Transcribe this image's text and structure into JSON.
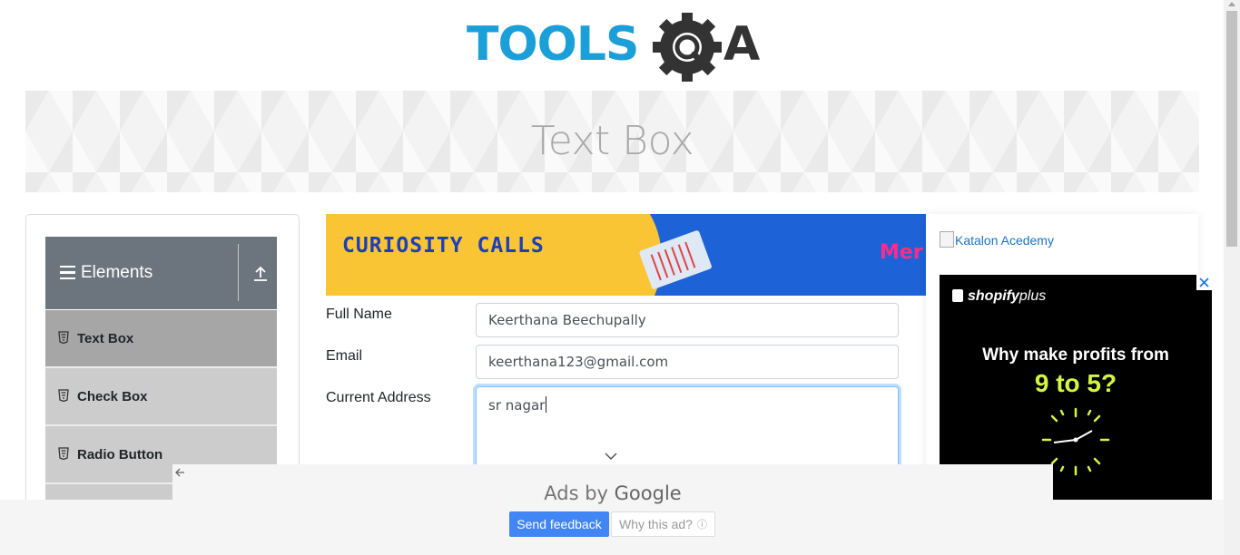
{
  "logo": {
    "text_left": "TOOLS",
    "text_right": "A",
    "brand_blue": "#1a9fd9",
    "brand_dark": "#333333"
  },
  "banner": {
    "title": "Text Box"
  },
  "sidebar": {
    "group_title": "Elements",
    "items": [
      {
        "label": "Text Box",
        "icon": "html5-icon",
        "active": true
      },
      {
        "label": "Check Box",
        "icon": "html5-icon",
        "active": false
      },
      {
        "label": "Radio Button",
        "icon": "html5-icon",
        "active": false
      }
    ]
  },
  "ad_banner": {
    "headline": "CURIOSITY CALLS",
    "brand_partial": "Mer"
  },
  "form": {
    "full_name": {
      "label": "Full Name",
      "value": "Keerthana Beechupally"
    },
    "email": {
      "label": "Email",
      "value": "keerthana123@gmail.com"
    },
    "current_address": {
      "label": "Current Address",
      "value": "sr nagar"
    }
  },
  "right": {
    "katalon_alt": "Katalon Acedemy",
    "shopify": {
      "brand": "shopify",
      "brand_suffix": "plus",
      "headline": "Why make profits from",
      "highlight": "9 to 5?",
      "accent": "#d4f542"
    }
  },
  "google_ads": {
    "ads_by": "Ads by",
    "google": "Google",
    "send_feedback": "Send feedback",
    "why_ad": "Why this ad?",
    "info_symbol": "ⓘ"
  },
  "colors": {
    "sidebar_header": "#6c757d",
    "active_item": "#a6a6a6",
    "item": "#cccccc",
    "focus": "#80bdff",
    "feedback_button": "#4285f4"
  }
}
